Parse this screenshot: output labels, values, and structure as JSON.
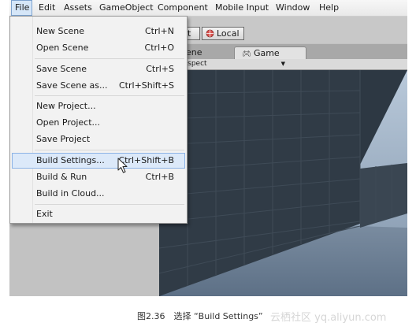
{
  "menubar": {
    "items": [
      {
        "label": "File"
      },
      {
        "label": "Edit"
      },
      {
        "label": "Assets"
      },
      {
        "label": "GameObject"
      },
      {
        "label": "Component"
      },
      {
        "label": "Mobile Input"
      },
      {
        "label": "Window"
      },
      {
        "label": "Help"
      }
    ]
  },
  "toolbar": {
    "pivot_partial": "t",
    "local_label": "Local"
  },
  "tabs": {
    "scene_partial": "ene",
    "game_label": "Game"
  },
  "aspect": {
    "label": "Aspect"
  },
  "file_menu": {
    "items": [
      {
        "label": "New Scene",
        "shortcut": "Ctrl+N"
      },
      {
        "label": "Open Scene",
        "shortcut": "Ctrl+O"
      },
      {
        "label": "Save Scene",
        "shortcut": "Ctrl+S"
      },
      {
        "label": "Save Scene as...",
        "shortcut": "Ctrl+Shift+S"
      },
      {
        "label": "New Project...",
        "shortcut": ""
      },
      {
        "label": "Open Project...",
        "shortcut": ""
      },
      {
        "label": "Save Project",
        "shortcut": ""
      },
      {
        "label": "Build Settings...",
        "shortcut": "Ctrl+Shift+B"
      },
      {
        "label": "Build & Run",
        "shortcut": "Ctrl+B"
      },
      {
        "label": "Build in Cloud...",
        "shortcut": ""
      },
      {
        "label": "Exit",
        "shortcut": ""
      }
    ]
  },
  "caption": {
    "text": "图2.36　选择 “Build Settings”",
    "watermark": "云栖社区 yq.aliyun.com"
  },
  "colors": {
    "menu_highlight": "#dce9f9",
    "menu_highlight_border": "#8cb3e6",
    "wall": "#2f3a45",
    "sky": "#8fa1b6"
  }
}
